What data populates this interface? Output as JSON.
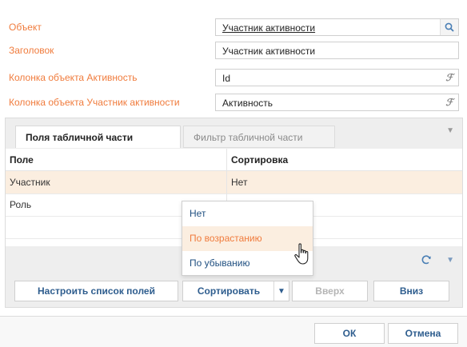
{
  "form": {
    "fields": [
      {
        "label": "Объект",
        "value": "Участник активности",
        "button_icon": "search-icon"
      },
      {
        "label": "Заголовок",
        "value": "Участник активности"
      },
      {
        "label": "Колонка объекта Активность",
        "value": "Id",
        "button_icon": "formula-icon"
      },
      {
        "label": "Колонка объекта Участник активности",
        "value": "Активность",
        "button_icon": "formula-icon"
      }
    ]
  },
  "tabs": [
    {
      "label": "Поля табличной части",
      "active": true
    },
    {
      "label": "Фильтр табличной части",
      "active": false
    }
  ],
  "grid": {
    "columns": [
      "Поле",
      "Сортировка"
    ],
    "rows": [
      [
        "Участник",
        "Нет"
      ],
      [
        "Роль",
        ""
      ]
    ]
  },
  "toolbar": {
    "configure_label": "Настроить список полей",
    "sort_label": "Сортировать",
    "up_label": "Вверх",
    "down_label": "Вниз"
  },
  "sort_menu": {
    "items": [
      "Нет",
      "По возрастанию",
      "По убыванию"
    ],
    "hovered": "По возрастанию"
  },
  "footer": {
    "ok_label": "ОК",
    "cancel_label": "Отмена"
  },
  "colors": {
    "label": "#f07b3c",
    "accent": "#2e5d8e",
    "hover_bg": "#fbeee0"
  }
}
